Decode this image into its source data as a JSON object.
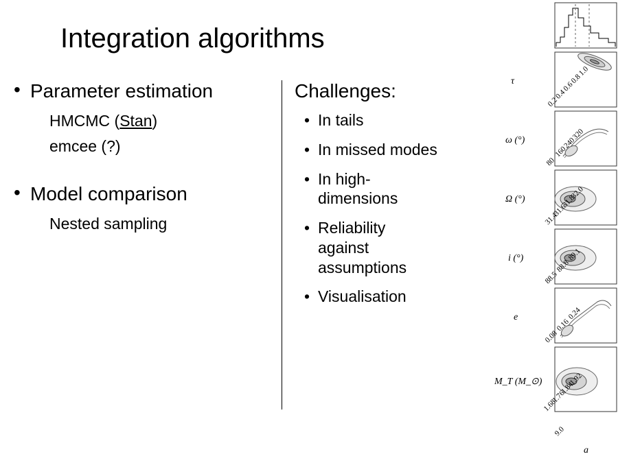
{
  "title": "Integration algorithms",
  "left": {
    "items": [
      {
        "label": "Parameter estimation",
        "sub": [
          {
            "prefix": "HMCMC (",
            "link": "Stan",
            "suffix": ")"
          },
          {
            "text": "emcee (?)"
          }
        ]
      },
      {
        "label": "Model comparison",
        "sub": [
          {
            "text": "Nested sampling"
          }
        ]
      }
    ]
  },
  "right": {
    "heading": "Challenges:",
    "items": [
      "In tails",
      "In missed modes",
      "In high-dimensions",
      "Reliability against assumptions",
      "Visualisation"
    ]
  },
  "cornerplot": {
    "params": [
      {
        "symbol": "τ",
        "ticks": [
          "0.2",
          "0.4",
          "0.6",
          "0.8",
          "1.0"
        ]
      },
      {
        "symbol": "ω (°)",
        "ticks": [
          "80",
          "160",
          "240",
          "320"
        ]
      },
      {
        "symbol": "Ω (°)",
        "ticks": [
          "31.4",
          "31.6",
          "31.8",
          "32.0"
        ]
      },
      {
        "symbol": "i (°)",
        "ticks": [
          "88.5",
          "88.8",
          "89.1"
        ]
      },
      {
        "symbol": "e",
        "ticks": [
          "0.08",
          "0.16",
          "0.24"
        ]
      },
      {
        "symbol": "M_T (M_⊙)",
        "ticks": [
          "1.68",
          "1.76",
          "1.84",
          "1.92"
        ]
      }
    ],
    "bottom_axis_symbol": "a",
    "bottom_axis_ticks": [
      "9.0"
    ]
  }
}
